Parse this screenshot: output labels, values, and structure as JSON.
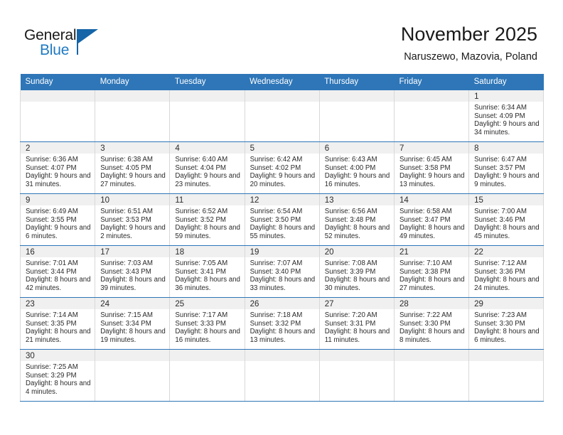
{
  "brand": {
    "name_part1": "General",
    "name_part2": "Blue",
    "accent_color": "#1f7ac1",
    "flag_color": "#1565a8"
  },
  "header": {
    "title": "November 2025",
    "subtitle": "Naruszewo, Mazovia, Poland",
    "header_bg_color": "#2E76B8",
    "header_text_color": "#FFFFFF"
  },
  "weekday_headers": [
    "Sunday",
    "Monday",
    "Tuesday",
    "Wednesday",
    "Thursday",
    "Friday",
    "Saturday"
  ],
  "labels": {
    "sunrise_prefix": "Sunrise:",
    "sunset_prefix": "Sunset:",
    "daylight_prefix": "Daylight:"
  },
  "weeks": [
    [
      {
        "day": "",
        "empty": true
      },
      {
        "day": "",
        "empty": true
      },
      {
        "day": "",
        "empty": true
      },
      {
        "day": "",
        "empty": true
      },
      {
        "day": "",
        "empty": true
      },
      {
        "day": "",
        "empty": true
      },
      {
        "day": "1",
        "sunrise": "Sunrise: 6:34 AM",
        "sunset": "Sunset: 4:09 PM",
        "daylight": "Daylight: 9 hours and 34 minutes."
      }
    ],
    [
      {
        "day": "2",
        "sunrise": "Sunrise: 6:36 AM",
        "sunset": "Sunset: 4:07 PM",
        "daylight": "Daylight: 9 hours and 31 minutes."
      },
      {
        "day": "3",
        "sunrise": "Sunrise: 6:38 AM",
        "sunset": "Sunset: 4:05 PM",
        "daylight": "Daylight: 9 hours and 27 minutes."
      },
      {
        "day": "4",
        "sunrise": "Sunrise: 6:40 AM",
        "sunset": "Sunset: 4:04 PM",
        "daylight": "Daylight: 9 hours and 23 minutes."
      },
      {
        "day": "5",
        "sunrise": "Sunrise: 6:42 AM",
        "sunset": "Sunset: 4:02 PM",
        "daylight": "Daylight: 9 hours and 20 minutes."
      },
      {
        "day": "6",
        "sunrise": "Sunrise: 6:43 AM",
        "sunset": "Sunset: 4:00 PM",
        "daylight": "Daylight: 9 hours and 16 minutes."
      },
      {
        "day": "7",
        "sunrise": "Sunrise: 6:45 AM",
        "sunset": "Sunset: 3:58 PM",
        "daylight": "Daylight: 9 hours and 13 minutes."
      },
      {
        "day": "8",
        "sunrise": "Sunrise: 6:47 AM",
        "sunset": "Sunset: 3:57 PM",
        "daylight": "Daylight: 9 hours and 9 minutes."
      }
    ],
    [
      {
        "day": "9",
        "sunrise": "Sunrise: 6:49 AM",
        "sunset": "Sunset: 3:55 PM",
        "daylight": "Daylight: 9 hours and 6 minutes."
      },
      {
        "day": "10",
        "sunrise": "Sunrise: 6:51 AM",
        "sunset": "Sunset: 3:53 PM",
        "daylight": "Daylight: 9 hours and 2 minutes."
      },
      {
        "day": "11",
        "sunrise": "Sunrise: 6:52 AM",
        "sunset": "Sunset: 3:52 PM",
        "daylight": "Daylight: 8 hours and 59 minutes."
      },
      {
        "day": "12",
        "sunrise": "Sunrise: 6:54 AM",
        "sunset": "Sunset: 3:50 PM",
        "daylight": "Daylight: 8 hours and 55 minutes."
      },
      {
        "day": "13",
        "sunrise": "Sunrise: 6:56 AM",
        "sunset": "Sunset: 3:48 PM",
        "daylight": "Daylight: 8 hours and 52 minutes."
      },
      {
        "day": "14",
        "sunrise": "Sunrise: 6:58 AM",
        "sunset": "Sunset: 3:47 PM",
        "daylight": "Daylight: 8 hours and 49 minutes."
      },
      {
        "day": "15",
        "sunrise": "Sunrise: 7:00 AM",
        "sunset": "Sunset: 3:46 PM",
        "daylight": "Daylight: 8 hours and 45 minutes."
      }
    ],
    [
      {
        "day": "16",
        "sunrise": "Sunrise: 7:01 AM",
        "sunset": "Sunset: 3:44 PM",
        "daylight": "Daylight: 8 hours and 42 minutes."
      },
      {
        "day": "17",
        "sunrise": "Sunrise: 7:03 AM",
        "sunset": "Sunset: 3:43 PM",
        "daylight": "Daylight: 8 hours and 39 minutes."
      },
      {
        "day": "18",
        "sunrise": "Sunrise: 7:05 AM",
        "sunset": "Sunset: 3:41 PM",
        "daylight": "Daylight: 8 hours and 36 minutes."
      },
      {
        "day": "19",
        "sunrise": "Sunrise: 7:07 AM",
        "sunset": "Sunset: 3:40 PM",
        "daylight": "Daylight: 8 hours and 33 minutes."
      },
      {
        "day": "20",
        "sunrise": "Sunrise: 7:08 AM",
        "sunset": "Sunset: 3:39 PM",
        "daylight": "Daylight: 8 hours and 30 minutes."
      },
      {
        "day": "21",
        "sunrise": "Sunrise: 7:10 AM",
        "sunset": "Sunset: 3:38 PM",
        "daylight": "Daylight: 8 hours and 27 minutes."
      },
      {
        "day": "22",
        "sunrise": "Sunrise: 7:12 AM",
        "sunset": "Sunset: 3:36 PM",
        "daylight": "Daylight: 8 hours and 24 minutes."
      }
    ],
    [
      {
        "day": "23",
        "sunrise": "Sunrise: 7:14 AM",
        "sunset": "Sunset: 3:35 PM",
        "daylight": "Daylight: 8 hours and 21 minutes."
      },
      {
        "day": "24",
        "sunrise": "Sunrise: 7:15 AM",
        "sunset": "Sunset: 3:34 PM",
        "daylight": "Daylight: 8 hours and 19 minutes."
      },
      {
        "day": "25",
        "sunrise": "Sunrise: 7:17 AM",
        "sunset": "Sunset: 3:33 PM",
        "daylight": "Daylight: 8 hours and 16 minutes."
      },
      {
        "day": "26",
        "sunrise": "Sunrise: 7:18 AM",
        "sunset": "Sunset: 3:32 PM",
        "daylight": "Daylight: 8 hours and 13 minutes."
      },
      {
        "day": "27",
        "sunrise": "Sunrise: 7:20 AM",
        "sunset": "Sunset: 3:31 PM",
        "daylight": "Daylight: 8 hours and 11 minutes."
      },
      {
        "day": "28",
        "sunrise": "Sunrise: 7:22 AM",
        "sunset": "Sunset: 3:30 PM",
        "daylight": "Daylight: 8 hours and 8 minutes."
      },
      {
        "day": "29",
        "sunrise": "Sunrise: 7:23 AM",
        "sunset": "Sunset: 3:30 PM",
        "daylight": "Daylight: 8 hours and 6 minutes."
      }
    ],
    [
      {
        "day": "30",
        "sunrise": "Sunrise: 7:25 AM",
        "sunset": "Sunset: 3:29 PM",
        "daylight": "Daylight: 8 hours and 4 minutes."
      },
      {
        "day": "",
        "empty": true
      },
      {
        "day": "",
        "empty": true
      },
      {
        "day": "",
        "empty": true
      },
      {
        "day": "",
        "empty": true
      },
      {
        "day": "",
        "empty": true
      },
      {
        "day": "",
        "empty": true
      }
    ]
  ]
}
